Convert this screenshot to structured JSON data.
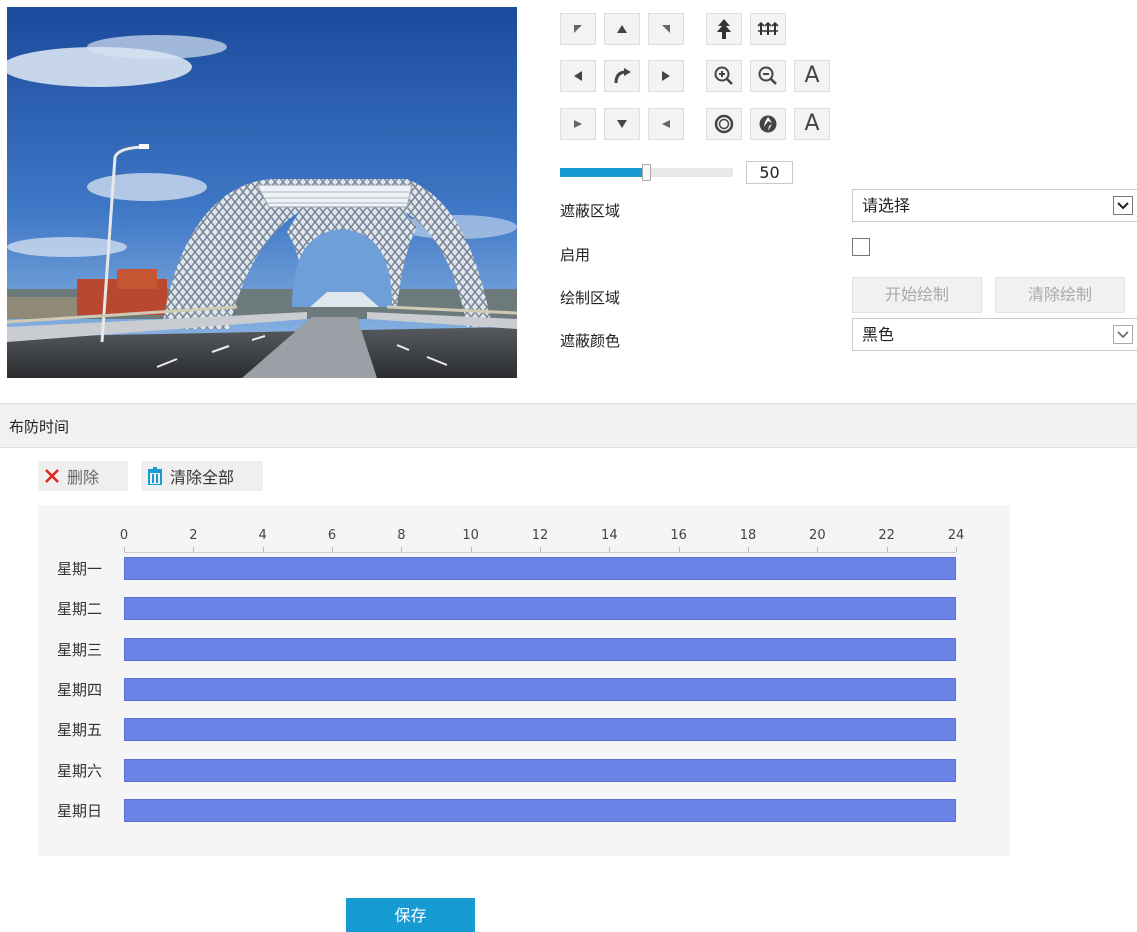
{
  "ptz": {
    "buttons": [
      {
        "icon": "pan-up-left-icon"
      },
      {
        "icon": "pan-up-icon"
      },
      {
        "icon": "pan-up-right-icon"
      },
      {
        "icon": "pan-left-icon"
      },
      {
        "icon": "auto-scan-icon"
      },
      {
        "icon": "pan-right-icon"
      },
      {
        "icon": "pan-down-left-icon"
      },
      {
        "icon": "pan-down-icon"
      },
      {
        "icon": "pan-down-right-icon"
      },
      {
        "icon": "focus-near-icon"
      },
      {
        "icon": "focus-far-icon"
      },
      {
        "icon": "zoom-in-icon"
      },
      {
        "icon": "zoom-out-icon"
      },
      {
        "icon": "auto-zoom-letter",
        "label": "A"
      },
      {
        "icon": "iris-open-icon"
      },
      {
        "icon": "iris-close-icon"
      },
      {
        "icon": "auto-iris-letter",
        "label": "A"
      }
    ],
    "speed": {
      "value": "50",
      "level": 0.5
    }
  },
  "mask_form": {
    "region_label": "遮蔽区域",
    "region_value": "请选择",
    "enable_label": "启用",
    "enable_checked": false,
    "draw_label": "绘制区域",
    "start_draw_label": "开始绘制",
    "clear_draw_label": "清除绘制",
    "color_label": "遮蔽颜色",
    "color_value": "黑色"
  },
  "schedule": {
    "title": "布防时间",
    "delete_label": "删除",
    "clear_all_label": "清除全部",
    "hours": [
      "0",
      "2",
      "4",
      "6",
      "8",
      "10",
      "12",
      "14",
      "16",
      "18",
      "20",
      "22",
      "24"
    ],
    "days": [
      {
        "label": "星期一",
        "start": 0,
        "end": 24
      },
      {
        "label": "星期二",
        "start": 0,
        "end": 24
      },
      {
        "label": "星期三",
        "start": 0,
        "end": 24
      },
      {
        "label": "星期四",
        "start": 0,
        "end": 24
      },
      {
        "label": "星期五",
        "start": 0,
        "end": 24
      },
      {
        "label": "星期六",
        "start": 0,
        "end": 24
      },
      {
        "label": "星期日",
        "start": 0,
        "end": 24
      }
    ],
    "bar_color": "#6b83e6"
  },
  "save_label": "保存",
  "colors": {
    "accent": "#179bd3",
    "delete_red": "#e0261f"
  }
}
